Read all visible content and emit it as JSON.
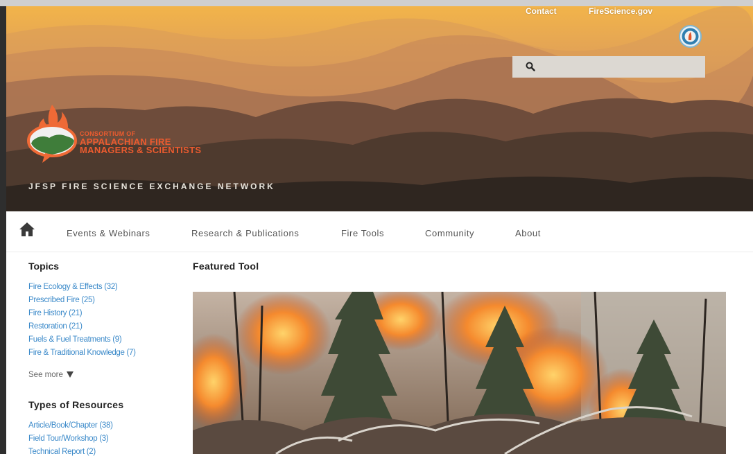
{
  "header": {
    "links": [
      "Contact",
      "FireScience.gov"
    ],
    "search": {
      "placeholder": "",
      "value": ""
    },
    "logo": {
      "line1": "CONSORTIUM OF",
      "line2": "APPALACHIAN FIRE",
      "line3": "MANAGERS & SCIENTISTS"
    },
    "network": "JFSP FIRE SCIENCE EXCHANGE NETWORK"
  },
  "nav": {
    "items": [
      "Events & Webinars",
      "Research & Publications",
      "Fire Tools",
      "Community",
      "About"
    ]
  },
  "sidebar": {
    "topics_title": "Topics",
    "topics": [
      "Fire Ecology & Effects (32)",
      "Prescribed Fire (25)",
      "Fire History (21)",
      "Restoration (21)",
      "Fuels & Fuel Treatments (9)",
      "Fire & Traditional Knowledge (7)"
    ],
    "see_more": "See more",
    "types_title": "Types of Resources",
    "types": [
      "Article/Book/Chapter (38)",
      "Field Tour/Workshop (3)",
      "Technical Report (2)"
    ]
  },
  "main": {
    "featured_title": "Featured Tool"
  },
  "colors": {
    "link": "#3a89c9",
    "logo_orange": "#ec5b2f",
    "logo_green": "#3f7d3a"
  },
  "icons": [
    "search-icon",
    "home-icon",
    "chevron-down-icon",
    "seal-icon"
  ]
}
